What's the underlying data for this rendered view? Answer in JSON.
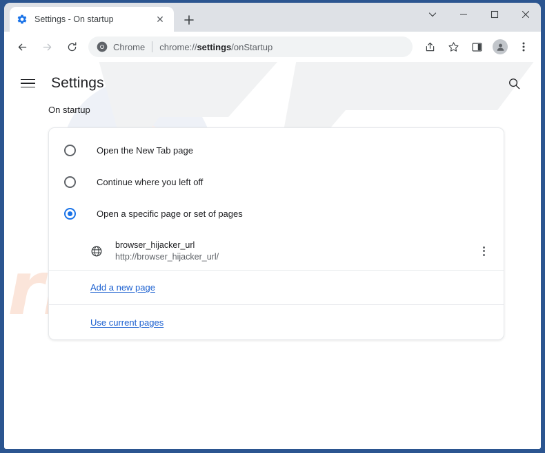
{
  "window": {
    "controls": {
      "tab_search_label": "⌄",
      "minimize_label": "—",
      "maximize_label": "□",
      "close_label": "✕"
    },
    "border_color": "#2b5590"
  },
  "tabs": {
    "active": {
      "title": "Settings - On startup",
      "favicon": "gear-icon",
      "close_label": "✕"
    },
    "new_tab_label": "+"
  },
  "toolbar": {
    "back_label": "←",
    "forward_label": "→",
    "reload_label": "⟳",
    "omnibox": {
      "brand_icon": "chrome-icon",
      "brand_label": "Chrome",
      "url_prefix": "chrome://",
      "url_bold": "settings",
      "url_suffix": "/onStartup",
      "full_url": "chrome://settings/onStartup"
    },
    "share_icon": "share-icon",
    "bookmark_icon": "star-icon",
    "side_panel_icon": "side-panel-icon",
    "profile_icon": "person-icon",
    "menu_icon": "three-dot-menu-icon"
  },
  "settings": {
    "title": "Settings",
    "menu_icon": "hamburger-icon",
    "search_icon": "search-icon",
    "section_label": "On startup",
    "startup_options": [
      {
        "label": "Open the New Tab page",
        "selected": false
      },
      {
        "label": "Continue where you left off",
        "selected": false
      },
      {
        "label": "Open a specific page or set of pages",
        "selected": true
      }
    ],
    "startup_pages": [
      {
        "name": "browser_hijacker_url",
        "url": "http://browser_hijacker_url/",
        "favicon": "globe-icon",
        "menu_icon": "three-dot-menu-icon"
      }
    ],
    "add_page_link": "Add a new page",
    "use_current_pages_link": "Use current pages",
    "accent_color": "#1a73e8",
    "link_color": "#1a5fd0"
  },
  "watermark": {
    "logo_text": "PC",
    "site_text": "risk.com"
  }
}
